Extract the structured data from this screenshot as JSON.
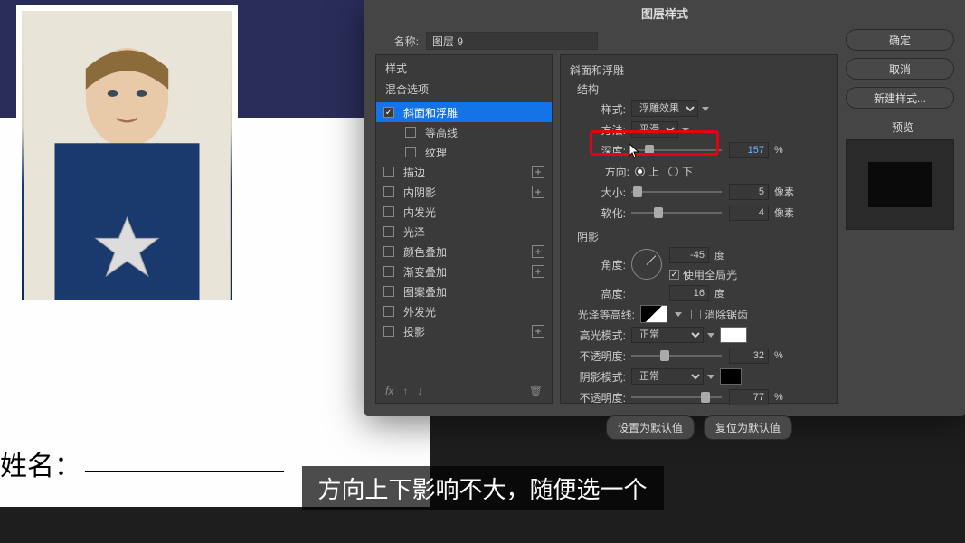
{
  "bg": {
    "name_label": "姓名："
  },
  "dialog": {
    "title": "图层样式",
    "name_label": "名称:",
    "name_value": "图层 9",
    "styles_header": "样式",
    "blend_options": "混合选项",
    "effects": {
      "bevel": "斜面和浮雕",
      "contour": "等高线",
      "texture": "纹理",
      "stroke": "描边",
      "inner_shadow": "内阴影",
      "inner_glow": "内发光",
      "satin": "光泽",
      "color_overlay": "颜色叠加",
      "gradient_overlay": "渐变叠加",
      "pattern_overlay": "图案叠加",
      "outer_glow": "外发光",
      "drop_shadow": "投影"
    },
    "bevel_panel": {
      "title": "斜面和浮雕",
      "structure": "结构",
      "style_label": "样式:",
      "style_value": "浮雕效果",
      "technique_label": "方法:",
      "technique_value": "平滑",
      "depth_label": "深度:",
      "depth_value": "157",
      "direction_label": "方向:",
      "direction_up": "上",
      "direction_down": "下",
      "size_label": "大小:",
      "size_value": "5",
      "soften_label": "软化:",
      "soften_value": "4",
      "percent": "%",
      "px": "像素",
      "shading": "阴影",
      "angle_label": "角度:",
      "angle_value": "-45",
      "deg": "度",
      "global_light": "使用全局光",
      "altitude_label": "高度:",
      "altitude_value": "16",
      "gloss_contour_label": "光泽等高线:",
      "anti_aliased": "消除锯齿",
      "highlight_mode_label": "高光模式:",
      "highlight_mode_value": "正常",
      "opacity_label": "不透明度:",
      "highlight_opacity": "32",
      "shadow_mode_label": "阴影模式:",
      "shadow_mode_value": "正常",
      "shadow_opacity": "77",
      "make_default": "设置为默认值",
      "reset_default": "复位为默认值"
    },
    "buttons": {
      "ok": "确定",
      "cancel": "取消",
      "new_style": "新建样式...",
      "preview": "预览"
    },
    "fx_label": "fx"
  },
  "subtitle": "方向上下影响不大，随便选一个"
}
